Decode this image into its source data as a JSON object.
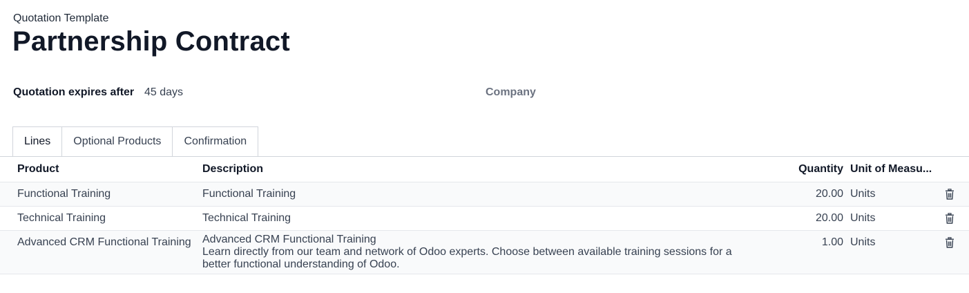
{
  "header": {
    "kicker": "Quotation Template",
    "title": "Partnership Contract"
  },
  "fields": {
    "expires_label": "Quotation expires after",
    "expires_value": "45 days",
    "company_label": "Company"
  },
  "tabs": [
    {
      "label": "Lines",
      "active": true
    },
    {
      "label": "Optional Products",
      "active": false
    },
    {
      "label": "Confirmation",
      "active": false
    }
  ],
  "table": {
    "columns": {
      "product": "Product",
      "description": "Description",
      "quantity": "Quantity",
      "uom": "Unit of Measu..."
    },
    "rows": [
      {
        "product": "Functional Training",
        "description": "Functional Training",
        "quantity": "20.00",
        "uom": "Units"
      },
      {
        "product": "Technical Training",
        "description": "Technical Training",
        "quantity": "20.00",
        "uom": "Units"
      },
      {
        "product": "Advanced CRM Functional Training",
        "description_line1": "Advanced CRM Functional Training",
        "description_line2": "Learn directly from our team and network of Odoo experts. Choose between available training sessions for a",
        "description_line3": "better functional understanding of Odoo.",
        "quantity": "1.00",
        "uom": "Units"
      }
    ]
  },
  "icons": {
    "delete": "trash-icon"
  },
  "colors": {
    "row_bg": "#f9fafb",
    "border": "#d1d5db"
  }
}
